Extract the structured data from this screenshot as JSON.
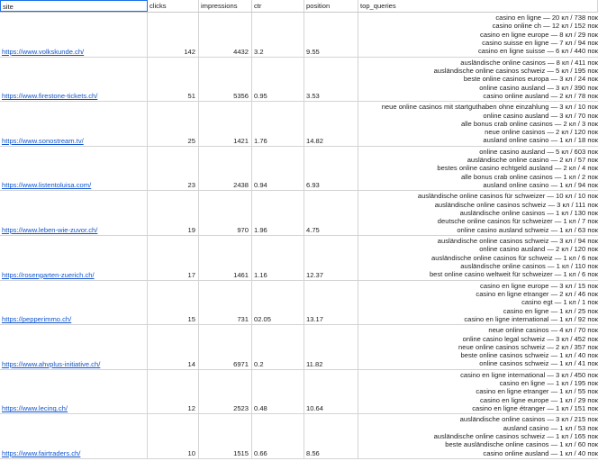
{
  "header": [
    "site",
    "clicks",
    "impressions",
    "ctr",
    "position",
    "top_queries"
  ],
  "rows": [
    {
      "site": "https://www.volkskunde.ch/",
      "clicks": "142",
      "impressions": "4432",
      "ctr": "3.2",
      "position": "9.55",
      "queries": [
        "casino en ligne — 20 кл / 738 пок",
        "casino online ch — 12 кл / 152 пок",
        "casino en ligne europe — 8 кл / 29 пок",
        "casino suisse en ligne — 7 кл / 94 пок",
        "casino en ligne suisse — 6 кл / 440 пок"
      ]
    },
    {
      "site": "https://www.firestone-tickets.ch/",
      "clicks": "51",
      "impressions": "5356",
      "ctr": "0.95",
      "position": "3.53",
      "queries": [
        "ausländische online casinos — 8 кл / 411 пок",
        "ausländische online casinos schweiz — 5 кл / 195 пок",
        "beste online casinos europa — 3 кл / 24 пок",
        "online casino ausland — 3 кл / 390 пок",
        "casino online ausland — 2 кл / 78 пок"
      ]
    },
    {
      "site": "https://www.sonostream.tv/",
      "clicks": "25",
      "impressions": "1421",
      "ctr": "1.76",
      "position": "14.82",
      "queries": [
        "neue online casinos mit startguthaben ohne einzahlung — 3 кл / 10 пок",
        "online casino ausland — 3 кл / 70 пок",
        "alle bonus crab online casinos — 2 кл / 3 пок",
        "neue online casinos — 2 кл / 120 пок",
        "ausland online casino — 1 кл / 18 пок"
      ]
    },
    {
      "site": "https://www.listentoluisa.com/",
      "clicks": "23",
      "impressions": "2438",
      "ctr": "0.94",
      "position": "6.93",
      "queries": [
        "online casino ausland — 5 кл / 603 пок",
        "ausländische online casino — 2 кл / 57 пок",
        "bestes online casino echtgeld ausland — 2 кл / 4 пок",
        "alle bonus crab online casinos — 1 кл / 2 пок",
        "ausland online casino — 1 кл / 94 пок"
      ]
    },
    {
      "site": "https://www.leben-wie-zuvor.ch/",
      "clicks": "19",
      "impressions": "970",
      "ctr": "1.96",
      "position": "4.75",
      "queries": [
        "ausländische online casinos für schweizer — 10 кл / 10 пок",
        "ausländische online casinos schweiz — 3 кл / 111 пок",
        "ausländische online casinos — 1 кл / 130 пок",
        "deutsche online casinos für schweizer — 1 кл / 7 пок",
        "online casino ausland schweiz — 1 кл / 63 пок"
      ]
    },
    {
      "site": "https://rosengarten-zuerich.ch/",
      "clicks": "17",
      "impressions": "1461",
      "ctr": "1.16",
      "position": "12.37",
      "queries": [
        "ausländische online casinos schweiz — 3 кл / 94 пок",
        "online casino ausland — 2 кл / 120 пок",
        "ausländische online casinos für schweiz — 1 кл / 6 пок",
        "ausländische online casinos — 1 кл / 110 пок",
        "best online casino weltweit für schweizer — 1 кл / 6 пок"
      ]
    },
    {
      "site": "https://pepperimmo.ch/",
      "clicks": "15",
      "impressions": "731",
      "ctr": "02.05",
      "position": "13.17",
      "queries": [
        "casino en ligne europe — 3 кл / 15 пок",
        "casino en ligne etranger — 2 кл / 46 пок",
        "casino egt — 1 кл / 1 пок",
        "casino en ligne — 1 кл / 25 пок",
        "casino en ligne international — 1 кл / 92 пок"
      ]
    },
    {
      "site": "https://www.ahvplus-initiative.ch/",
      "clicks": "14",
      "impressions": "6971",
      "ctr": "0.2",
      "position": "11.82",
      "queries": [
        "neue online casinos — 4 кл / 70 пок",
        "online casino legal schweiz — 3 кл / 452 пок",
        "neue online casinos schweiz — 2 кл / 357 пок",
        "beste online casinos schweiz — 1 кл / 40 пок",
        "online casinos schweiz — 1 кл / 41 пок"
      ]
    },
    {
      "site": "https://www.lecinq.ch/",
      "clicks": "12",
      "impressions": "2523",
      "ctr": "0.48",
      "position": "10.64",
      "queries": [
        "casino en ligne international — 3 кл / 450 пок",
        "casino en ligne — 1 кл / 195 пок",
        "casino en ligne etranger — 1 кл / 55 пок",
        "casino en ligne europe — 1 кл / 29 пок",
        "casino en ligne étranger — 1 кл / 151 пок"
      ]
    },
    {
      "site": "https://www.fairtraders.ch/",
      "clicks": "10",
      "impressions": "1515",
      "ctr": "0.66",
      "position": "8.56",
      "queries": [
        "ausländische online casinos — 3 кл / 215 пок",
        "ausland casino — 1 кл / 53 пок",
        "ausländische online casinos schweiz — 1 кл / 165 пок",
        "beste ausländische online casinos — 1 кл / 60 пок",
        "casino online ausland — 1 кл / 40 пок"
      ]
    }
  ]
}
